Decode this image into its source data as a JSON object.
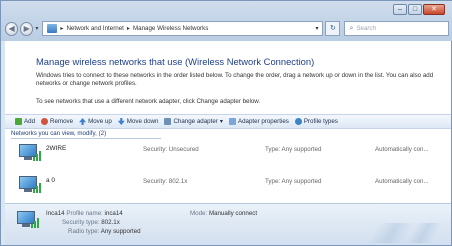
{
  "window": {
    "controls": {
      "minimize": "–",
      "maximize": "□",
      "close": "✕"
    }
  },
  "navbar": {
    "back_glyph": "◀",
    "forward_glyph": "▶",
    "dropdown_glyph": "▾",
    "address_sep": "▸",
    "breadcrumb": [
      "Network and Internet",
      "Manage Wireless Networks"
    ],
    "address_arrow": "▾",
    "refresh_glyph": "↻",
    "search_placeholder": "Search",
    "search_glyph": "⌕"
  },
  "content": {
    "heading": "Manage wireless networks that use (Wireless Network Connection)",
    "desc1": "Windows tries to connect to these networks in the order listed below. To change the order, drag a network up or down in the list. You can also add networks or change network profiles.",
    "desc2": "To see networks that use a different network adapter, click Change adapter below."
  },
  "toolbar": {
    "items": [
      {
        "label": "Add",
        "icon": "add-icon"
      },
      {
        "label": "Remove",
        "icon": "remove-icon"
      },
      {
        "label": "Move up",
        "icon": "arrow-up-icon"
      },
      {
        "label": "Move down",
        "icon": "arrow-down-icon"
      },
      {
        "label": "Change adapter",
        "icon": "adapter-icon",
        "dropdown": "▾"
      },
      {
        "label": "Adapter properties",
        "icon": "properties-icon"
      },
      {
        "label": "Profile types",
        "icon": "profile-types-icon"
      }
    ]
  },
  "list": {
    "group_header": "Networks you can view, modify, (2)",
    "networks": [
      {
        "name": "2WIRE",
        "security": "Security: Unsecured",
        "type": "Type: Any supported",
        "mode": "Automatically con..."
      },
      {
        "name": "a 0",
        "security": "Security: 802.1x",
        "type": "Type: Any supported",
        "mode": "Automatically con..."
      }
    ]
  },
  "details": {
    "name": "Inca14",
    "profile_label": "Profile name:",
    "profile_value": "inca14",
    "mode_label": "Mode:",
    "mode_value": "Manually connect",
    "security_label": "Security type:",
    "security_value": "802.1x",
    "radio_label": "Radio type:",
    "radio_value": "Any supported"
  },
  "colors": {
    "heading": "#1e3f8a",
    "signal": "#2fa84a",
    "close_button": "#c8462a"
  }
}
